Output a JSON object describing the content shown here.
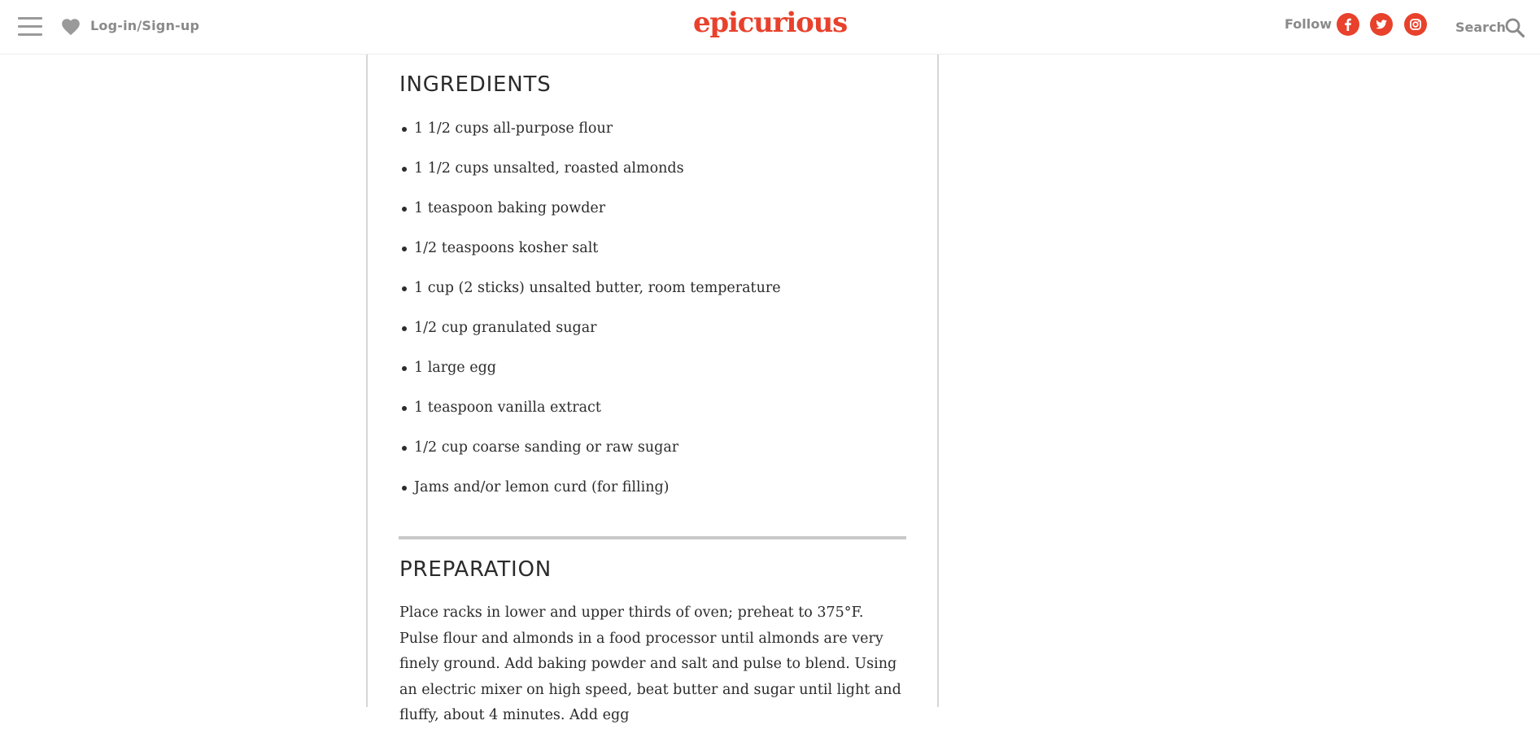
{
  "header": {
    "login_label": "Log-in/Sign-up",
    "logo": "epicurious",
    "follow_label": "Follow",
    "search_label": "Search",
    "brand_color": "#e8412c",
    "icons": [
      "menu-icon",
      "heart-icon",
      "facebook-icon",
      "twitter-icon",
      "instagram-icon",
      "search-icon"
    ]
  },
  "ingredients": {
    "heading": "INGREDIENTS",
    "items": [
      "1 1/2 cups all-purpose flour",
      "1 1/2 cups unsalted, roasted almonds",
      "1 teaspoon baking powder",
      "1/2 teaspoons kosher salt",
      "1 cup (2 sticks) unsalted butter, room temperature",
      "1/2 cup granulated sugar",
      "1 large egg",
      "1 teaspoon vanilla extract",
      "1/2 cup coarse sanding or raw sugar",
      "Jams and/or lemon curd (for filling)"
    ]
  },
  "preparation": {
    "heading": "PREPARATION",
    "text": "Place racks in lower and upper thirds of oven; preheat to 375°F. Pulse flour and almonds in a food processor until almonds are very finely ground. Add baking powder and salt and pulse to blend. Using an electric mixer on high speed, beat butter and sugar until light and fluffy, about 4 minutes. Add egg"
  }
}
